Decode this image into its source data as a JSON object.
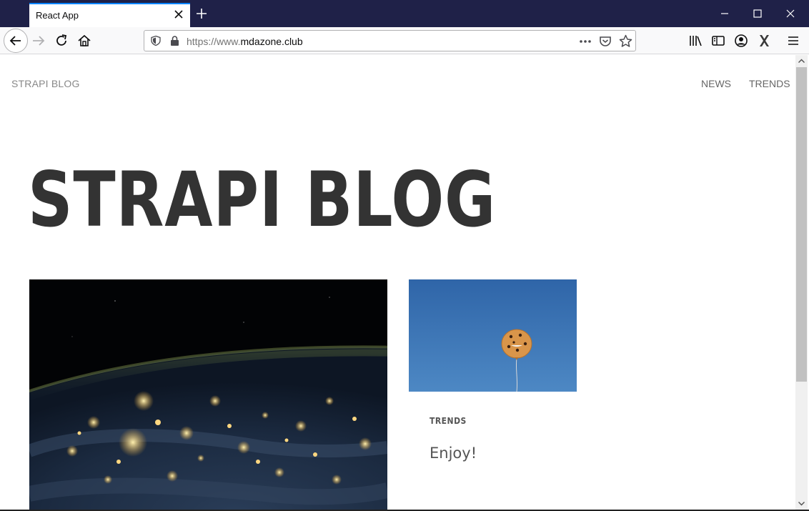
{
  "browser": {
    "tab_title": "React App",
    "url_prefix": "https://www.",
    "url_domain": "mdazone.club",
    "accent": "#0a84ff",
    "titlebar_color": "#1f2148",
    "icons": [
      "back-icon",
      "forward-icon",
      "reload-icon",
      "home-icon",
      "shield-icon",
      "lock-icon",
      "more-icon",
      "pocket-icon",
      "star-icon",
      "library-icon",
      "sidebar-icon",
      "account-icon",
      "extension-x-icon",
      "menu-icon",
      "minimize-icon",
      "maximize-icon",
      "close-icon",
      "new-tab-icon"
    ]
  },
  "site": {
    "brand": "STRAPI BLOG",
    "nav": [
      {
        "label": "NEWS"
      },
      {
        "label": "TRENDS"
      }
    ],
    "hero_title": "STRAPI BLOG",
    "cards": [
      {
        "image": "earth-at-night",
        "category": "",
        "title": ""
      },
      {
        "image": "cookie-balloon-sky",
        "category": "TRENDS",
        "title": "Enjoy!"
      }
    ]
  }
}
